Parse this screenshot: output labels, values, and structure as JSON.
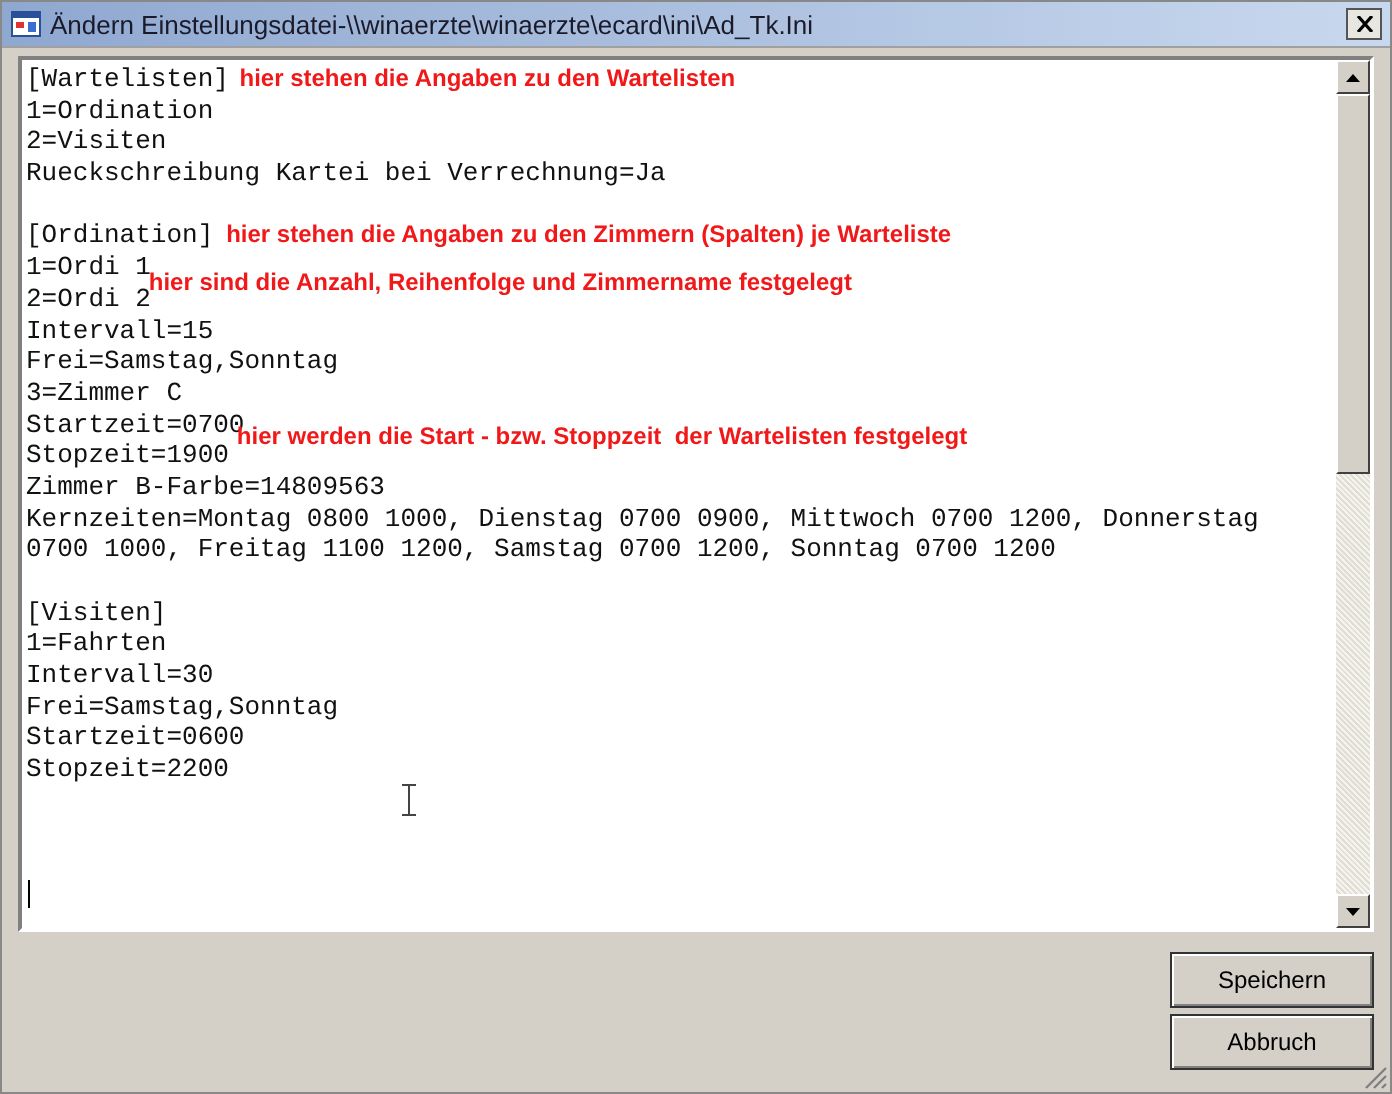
{
  "window": {
    "title": "Ändern Einstellungsdatei-\\\\winaerzte\\winaerzte\\ecard\\ini\\Ad_Tk.Ini"
  },
  "editor": {
    "sections": [
      {
        "lines": [
          {
            "text": "[Wartelisten]",
            "note": "hier stehen die Angaben zu den Wartelisten"
          },
          {
            "text": "1=Ordination"
          },
          {
            "text": "2=Visiten"
          },
          {
            "text": "Rueckschreibung Kartei bei Verrechnung=Ja"
          }
        ]
      },
      {
        "lines": [
          {
            "text": "[Ordination]",
            "note": "hier stehen die Angaben zu den Zimmern (Spalten) je Warteliste"
          },
          {
            "text": "1=Ordi 1",
            "note": "hier sind die Anzahl, Reihenfolge und Zimmername festgelegt"
          },
          {
            "text": "2=Ordi 2"
          },
          {
            "text": "Intervall=15"
          },
          {
            "text": "Frei=Samstag,Sonntag"
          },
          {
            "text": "3=Zimmer C"
          },
          {
            "text": "Startzeit=0700",
            "note": "hier werden die Start - bzw. Stoppzeit  der Wartelisten festgelegt"
          },
          {
            "text": "Stopzeit=1900"
          },
          {
            "text": "Zimmer B-Farbe=14809563"
          },
          {
            "text": "Kernzeiten=Montag 0800 1000, Dienstag 0700 0900, Mittwoch 0700 1200, Donnerstag"
          },
          {
            "text": "0700 1000, Freitag 1100 1200, Samstag 0700 1200, Sonntag 0700 1200"
          }
        ]
      },
      {
        "lines": [
          {
            "text": "[Visiten]"
          },
          {
            "text": "1=Fahrten"
          },
          {
            "text": "Intervall=30"
          },
          {
            "text": "Frei=Samstag,Sonntag"
          },
          {
            "text": "Startzeit=0600"
          },
          {
            "text": "Stopzeit=2200"
          }
        ]
      }
    ]
  },
  "buttons": [
    {
      "label": "Speichern"
    },
    {
      "label": "Abbruch"
    }
  ]
}
